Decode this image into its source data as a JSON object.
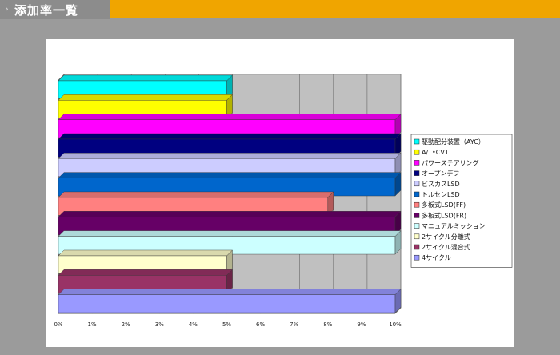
{
  "header": {
    "title": "添加率一覧"
  },
  "chart_data": {
    "type": "bar",
    "orientation": "horizontal",
    "categories": [
      "駆動配分装置（AYC）",
      "A/T•CVT",
      "パワーステアリング",
      "オープンデフ",
      "ビスカスLSD",
      "トルセンLSD",
      "多板式LSD(FF)",
      "多板式LSD(FR)",
      "マニュアルミッション",
      "2サイクル分離式",
      "2サイクル混合式",
      "4サイクル"
    ],
    "values": [
      5,
      5,
      10,
      10,
      10,
      10,
      8,
      10,
      10,
      5,
      5,
      10
    ],
    "colors": [
      "#00ffff",
      "#ffff00",
      "#ff00ff",
      "#000080",
      "#ccccff",
      "#0066cc",
      "#ff8080",
      "#660066",
      "#ccffff",
      "#ffffcc",
      "#993366",
      "#9999ff"
    ],
    "xlim": [
      0,
      10
    ],
    "xticks": [
      "0%",
      "1%",
      "2%",
      "3%",
      "4%",
      "5%",
      "6%",
      "7%",
      "8%",
      "9%",
      "10%"
    ],
    "grid": true,
    "legend_position": "right"
  }
}
